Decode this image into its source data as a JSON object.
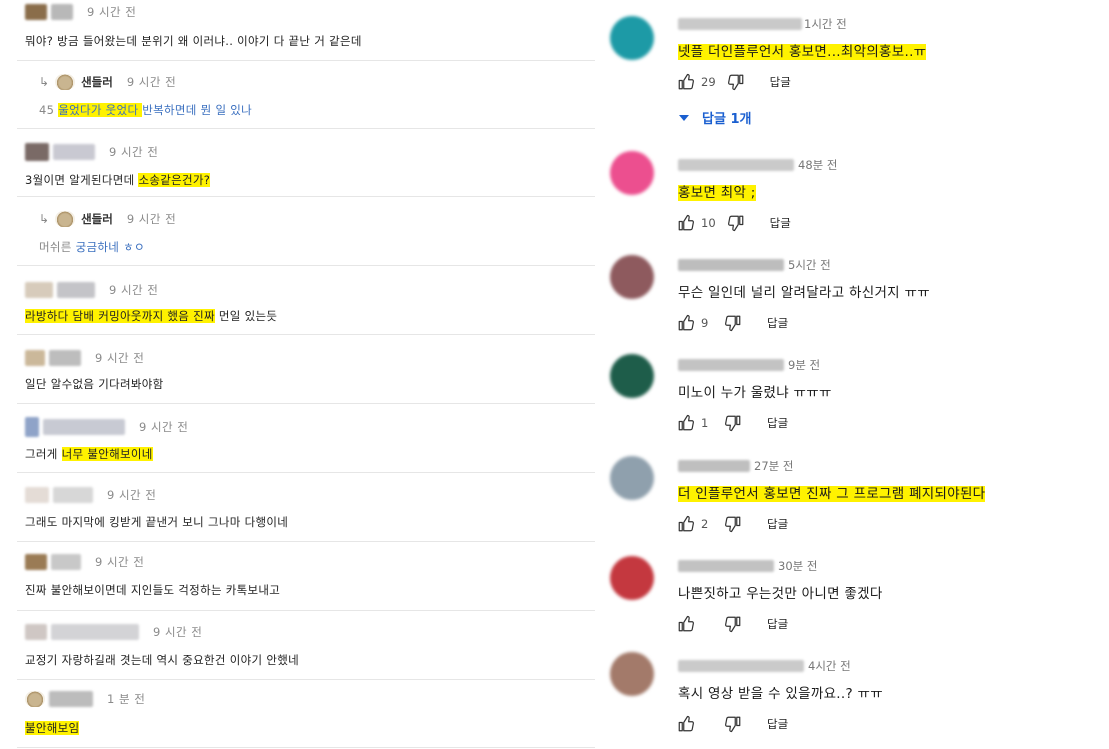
{
  "left_comments": [
    {
      "kind": "comment",
      "author": "",
      "time": "9 시간 전",
      "text": "뭐야? 방금 들어왔는데 분위기 왜 이러냐.. 이야기 다 끝난 거 같은데",
      "avatar_color": "#8a6d4a"
    },
    {
      "kind": "reply",
      "author": "샌들러",
      "time": "9 시간 전",
      "mention": "45",
      "text_hl": "울었다가 웃었다 ",
      "text_rest": "반복하면데 뭔 일 있나"
    },
    {
      "kind": "comment",
      "author": "",
      "time": "9 시간 전",
      "text_plain": "3월이면 알게된다면데 ",
      "text_hl": "소송같은건가?",
      "avatar_color": "#7a6a66"
    },
    {
      "kind": "reply",
      "author": "샌들러",
      "time": "9 시간 전",
      "mention": "머쉬른",
      "text": "궁금하네 ㅎㅇ"
    },
    {
      "kind": "comment",
      "author": "",
      "time": "9 시간 전",
      "text_hl": "라방하다 담배 커밍아웃까지 했음 진짜",
      "text_rest": " 먼일 있는듯",
      "avatar_color": "#d7cbbb"
    },
    {
      "kind": "comment",
      "author": "",
      "time": "9 시간 전",
      "text": "일단 알수없음 기다려봐야함",
      "avatar_color": "#cbb89a"
    },
    {
      "kind": "comment",
      "author": "",
      "time": "9 시간 전",
      "text_plain": "그러게 ",
      "text_hl": "너무 불안해보이네",
      "avatar_color": "#8fa3c8"
    },
    {
      "kind": "comment",
      "author": "",
      "time": "9 시간 전",
      "text": "그래도 마지막에 킹받게 끝낸거 보니 그나마 다행이네",
      "avatar_color": "#e4dcd6"
    },
    {
      "kind": "comment",
      "author": "",
      "time": "9 시간 전",
      "text": "진짜 불안해보이면데 지인들도 걱정하는 카톡보내고",
      "avatar_color": "#9a7b55"
    },
    {
      "kind": "comment",
      "author": "",
      "time": "9 시간 전",
      "text": "교정기 자랑하길래 겻는데 역시 중요한건 이야기 안했네",
      "avatar_color": "#cfc7c4"
    },
    {
      "kind": "comment",
      "author": "",
      "time": "1 분 전",
      "text_hl": "불안해보임",
      "avatar_color": "#c8b28a"
    }
  ],
  "right_comments": [
    {
      "author": "",
      "time": "1시간 전",
      "text": "넷플 더인플루언서 홍보면...최악의홍보..ㅠ",
      "highlight": true,
      "likes": "29",
      "avatar_color": "#1d9aa6",
      "show_replies": "답글 1개"
    },
    {
      "author": "",
      "time": "48분 전",
      "text": "홍보면 최악 ;",
      "highlight": true,
      "likes": "10",
      "avatar_color": "#ec4f8f"
    },
    {
      "author": "",
      "time": "5시간 전",
      "text": "무슨 일인데 널리 알려달라고 하신거지 ㅠㅠ",
      "highlight": false,
      "likes": "9",
      "avatar_color": "#8e5a5e"
    },
    {
      "author": "",
      "time": "9분 전",
      "text": "미노이 누가 울렸냐 ㅠㅠㅠ",
      "highlight": false,
      "likes": "1",
      "avatar_color": "#1e5d4a"
    },
    {
      "author": "",
      "time": "27분 전",
      "text": "더 인플루언서 홍보면 진짜 그 프로그램 폐지되야된다",
      "highlight": true,
      "likes": "2",
      "avatar_color": "#8fa0ad"
    },
    {
      "author": "",
      "time": "30분 전",
      "text": "나쁜짓하고 우는것만 아니면 좋겠다",
      "highlight": false,
      "likes": "",
      "avatar_color": "#c4383f"
    },
    {
      "author": "",
      "time": "4시간 전",
      "text": "혹시 영상 받을 수 있을까요..? ㅠㅠ",
      "highlight": false,
      "likes": "",
      "avatar_color": "#a37a6a"
    }
  ],
  "labels": {
    "reply": "답글"
  },
  "colors": {
    "highlight": "#fff200",
    "link_blue": "#1a5fd0"
  },
  "icons": {
    "like": "thumbs-up-icon",
    "dislike": "thumbs-down-icon",
    "reply_arrow": "reply-arrow-icon",
    "expand": "caret-down-icon"
  }
}
